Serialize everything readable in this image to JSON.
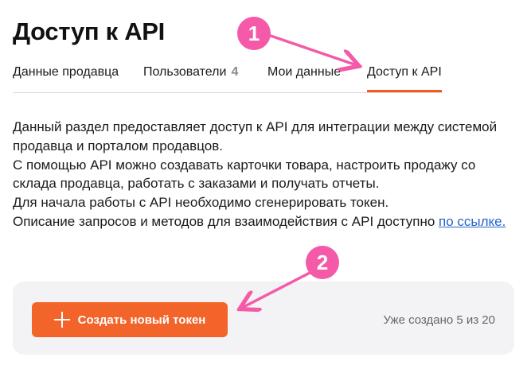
{
  "page": {
    "title": "Доступ к API"
  },
  "tabs": [
    {
      "label": "Данные продавца"
    },
    {
      "label": "Пользователи",
      "count": "4"
    },
    {
      "label": "Мои данные"
    },
    {
      "label": "Доступ к API",
      "active": true
    }
  ],
  "description": {
    "line1": "Данный раздел предоставляет доступ к API для интеграции между системой продавца и порталом продавцов.",
    "line2": "С помощью API можно создавать карточки товара, настроить продажу со склада продавца, работать с заказами и получать отчеты.",
    "line3": "Для начала работы с API необходимо сгенерировать токен.",
    "line4": "Описание запросов и методов для взаимодействия с API доступно ",
    "link": "по ссылке."
  },
  "token_panel": {
    "create_button_label": "Создать новый токен",
    "created_status": "Уже создано 5 из 20"
  },
  "annotations": {
    "step1": "1",
    "step2": "2"
  },
  "colors": {
    "accent": "#f2642a",
    "annotation": "#f45aa8",
    "link": "#2a63c9"
  },
  "icons": {
    "create_button": "plus-icon"
  }
}
